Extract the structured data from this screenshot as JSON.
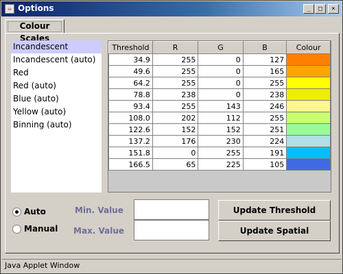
{
  "window": {
    "title": "Options",
    "minimize": "_",
    "maximize": "□",
    "close": "×"
  },
  "tabs": [
    {
      "label": "Colour Scales"
    }
  ],
  "scales": {
    "items": [
      "Incandescent",
      "Incandescent (auto)",
      "Red",
      "Red (auto)",
      "Blue (auto)",
      "Yellow (auto)",
      "Binning (auto)"
    ],
    "selected": "Incandescent"
  },
  "table": {
    "headers": [
      "Threshold",
      "R",
      "G",
      "B",
      "Colour"
    ],
    "rows": [
      {
        "threshold": "34.9",
        "r": "255",
        "g": "0",
        "b": "127",
        "colour": "#ff7f00"
      },
      {
        "threshold": "49.6",
        "r": "255",
        "g": "0",
        "b": "165",
        "colour": "#ffa500"
      },
      {
        "threshold": "64.2",
        "r": "255",
        "g": "0",
        "b": "255",
        "colour": "#ffff00"
      },
      {
        "threshold": "78.8",
        "r": "238",
        "g": "0",
        "b": "238",
        "colour": "#eeee00"
      },
      {
        "threshold": "93.4",
        "r": "255",
        "g": "143",
        "b": "246",
        "colour": "#fff68f"
      },
      {
        "threshold": "108.0",
        "r": "202",
        "g": "112",
        "b": "255",
        "colour": "#caff70"
      },
      {
        "threshold": "122.6",
        "r": "152",
        "g": "152",
        "b": "251",
        "colour": "#98fb98"
      },
      {
        "threshold": "137.2",
        "r": "176",
        "g": "230",
        "b": "224",
        "colour": "#b0e0e6"
      },
      {
        "threshold": "151.8",
        "r": "0",
        "g": "255",
        "b": "191",
        "colour": "#00bfff"
      },
      {
        "threshold": "166.5",
        "r": "65",
        "g": "225",
        "b": "105",
        "colour": "#4169e1"
      }
    ]
  },
  "mode": {
    "auto_label": "Auto",
    "manual_label": "Manual",
    "selected": "Auto"
  },
  "range": {
    "min_label": "Min. Value",
    "max_label": "Max. Value",
    "min_value": "",
    "max_value": ""
  },
  "buttons": {
    "update_threshold": "Update Threshold",
    "update_spatial": "Update Spatial"
  },
  "status_bar": "Java Applet Window"
}
